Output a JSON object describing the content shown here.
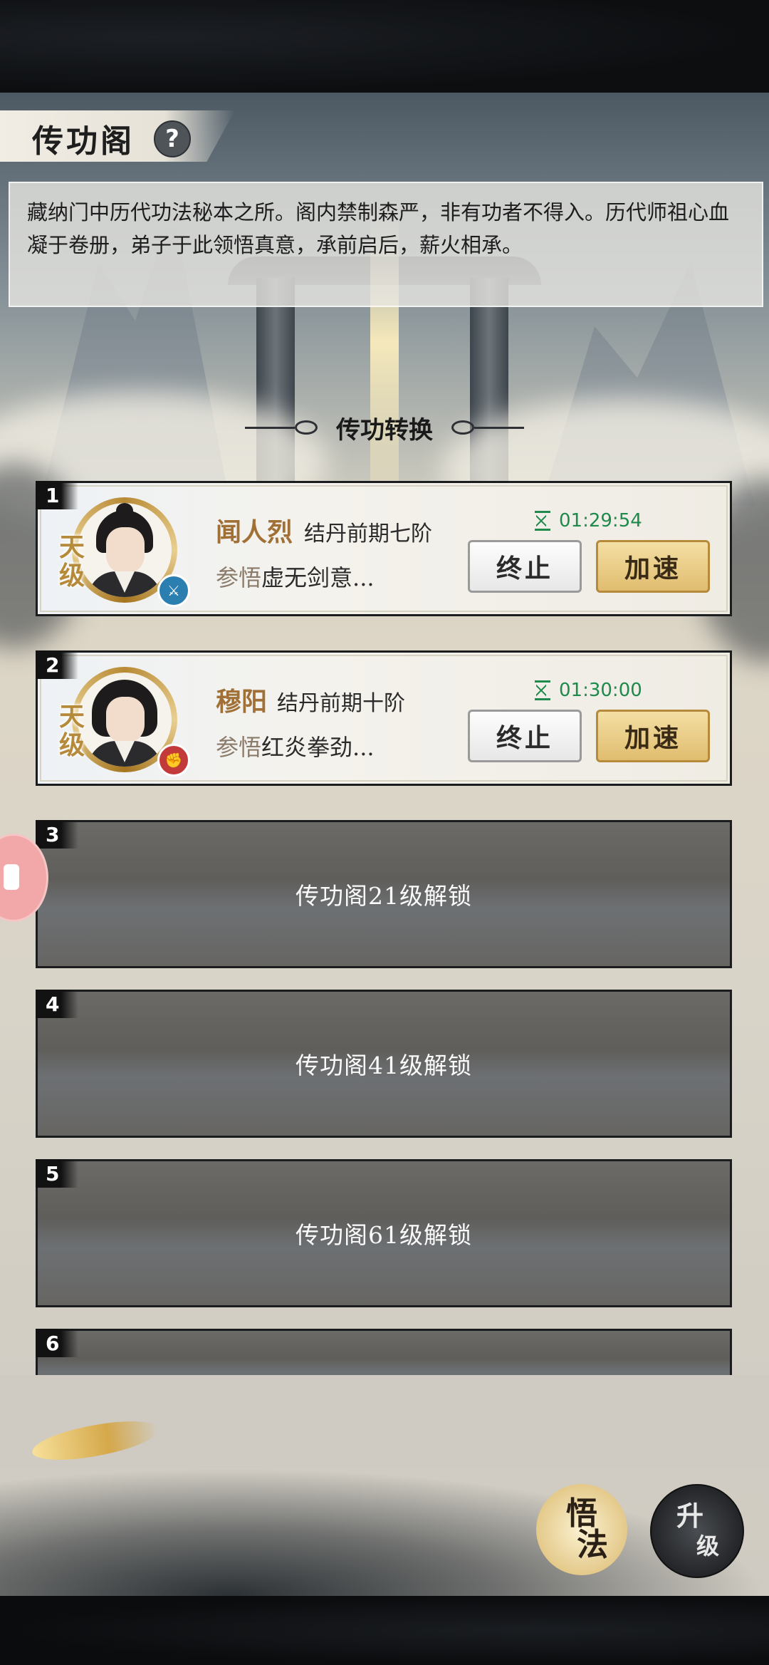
{
  "header": {
    "title": "传功阁",
    "help_icon": "?",
    "description": "藏纳门中历代功法秘本之所。阁内禁制森严，非有功者不得入。历代师祖心血凝于卷册，弟子于此领悟真意，承前启后，薪火相承。"
  },
  "section": {
    "title": "传功转换"
  },
  "slots": [
    {
      "number": "1",
      "grade": "天级",
      "name": "闻人烈",
      "rank": "结丹前期七阶",
      "study_prefix": "参悟",
      "study_text": "虚无剑意...",
      "timer": "01:29:54",
      "element_icon": "sword-element-icon",
      "element_color": "#2b7fb0",
      "stop_label": "终止",
      "speed_label": "加速"
    },
    {
      "number": "2",
      "grade": "天级",
      "name": "穆阳",
      "rank": "结丹前期十阶",
      "study_prefix": "参悟",
      "study_text": "红炎拳劲...",
      "timer": "01:30:00",
      "element_icon": "fist-element-icon",
      "element_color": "#c23a3a",
      "stop_label": "终止",
      "speed_label": "加速"
    },
    {
      "number": "3",
      "locked_text": "传功阁21级解锁"
    },
    {
      "number": "4",
      "locked_text": "传功阁41级解锁"
    },
    {
      "number": "5",
      "locked_text": "传功阁61级解锁"
    },
    {
      "number": "6"
    }
  ],
  "footer": {
    "wufa_label_1": "悟",
    "wufa_label_2": "法",
    "shengji_label_1": "升",
    "shengji_label_2": "级"
  },
  "colors": {
    "accent_gold": "#e0bd6f",
    "timer_green": "#1e8a4c",
    "name_brown": "#a07037"
  }
}
